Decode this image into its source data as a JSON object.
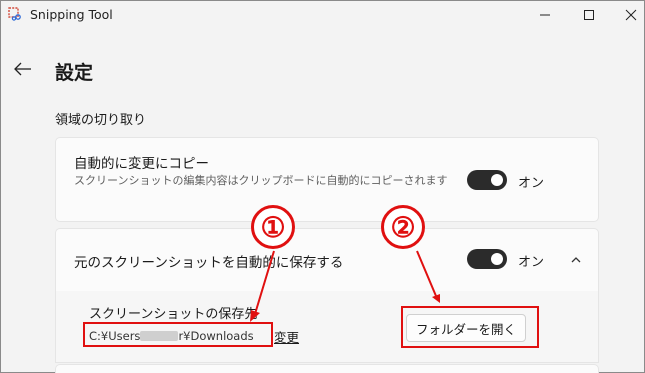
{
  "window": {
    "title": "Snipping Tool",
    "controls": {
      "minimize": "—",
      "maximize": "☐",
      "close": "✕"
    }
  },
  "header": {
    "back_icon": "arrow-left-icon",
    "title": "設定"
  },
  "section": {
    "title": "領域の切り取り"
  },
  "settings": {
    "auto_copy": {
      "title": "自動的に変更にコピー",
      "description": "スクリーンショットの編集内容はクリップボードに自動的にコピーされます",
      "toggle_state": "オン",
      "enabled": true
    },
    "auto_save": {
      "title": "元のスクリーンショットを自動的に保存する",
      "toggle_state": "オン",
      "enabled": true,
      "expanded": true,
      "save_location_label": "スクリーンショットの保存先",
      "path_prefix": "C:¥Users",
      "path_suffix": "r¥Downloads",
      "change_link": "変更",
      "open_folder_button": "フォルダーを開く"
    }
  },
  "annotations": {
    "one": "①",
    "two": "②",
    "color": "#e01010"
  }
}
